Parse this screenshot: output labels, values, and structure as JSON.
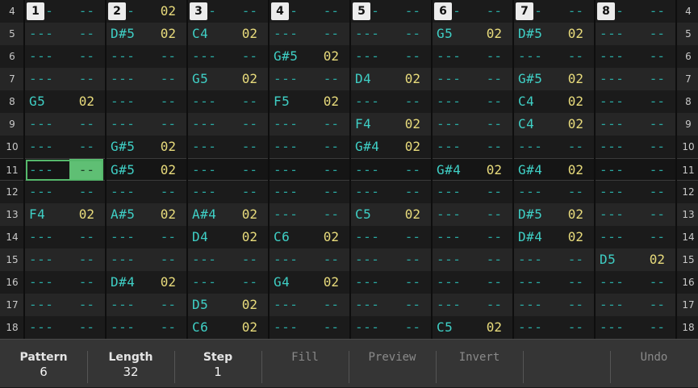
{
  "channels": [
    {
      "label": "1"
    },
    {
      "label": "2"
    },
    {
      "label": "3"
    },
    {
      "label": "4"
    },
    {
      "label": "5"
    },
    {
      "label": "6"
    },
    {
      "label": "7"
    },
    {
      "label": "8"
    }
  ],
  "rows": [
    {
      "num": "4",
      "cells": [
        [
          "---",
          "--"
        ],
        [
          "---",
          "02"
        ],
        [
          "---",
          "--"
        ],
        [
          "---",
          "--"
        ],
        [
          "---",
          "--"
        ],
        [
          "---",
          "--"
        ],
        [
          "---",
          "--"
        ],
        [
          "---",
          "--"
        ]
      ]
    },
    {
      "num": "5",
      "cells": [
        [
          "---",
          "--"
        ],
        [
          "D#5",
          "02"
        ],
        [
          "C4",
          "02"
        ],
        [
          "---",
          "--"
        ],
        [
          "---",
          "--"
        ],
        [
          "G5",
          "02"
        ],
        [
          "D#5",
          "02"
        ],
        [
          "---",
          "--"
        ]
      ]
    },
    {
      "num": "6",
      "cells": [
        [
          "---",
          "--"
        ],
        [
          "---",
          "--"
        ],
        [
          "---",
          "--"
        ],
        [
          "G#5",
          "02"
        ],
        [
          "---",
          "--"
        ],
        [
          "---",
          "--"
        ],
        [
          "---",
          "--"
        ],
        [
          "---",
          "--"
        ]
      ]
    },
    {
      "num": "7",
      "cells": [
        [
          "---",
          "--"
        ],
        [
          "---",
          "--"
        ],
        [
          "G5",
          "02"
        ],
        [
          "---",
          "--"
        ],
        [
          "D4",
          "02"
        ],
        [
          "---",
          "--"
        ],
        [
          "G#5",
          "02"
        ],
        [
          "---",
          "--"
        ]
      ]
    },
    {
      "num": "8",
      "cells": [
        [
          "G5",
          "02"
        ],
        [
          "---",
          "--"
        ],
        [
          "---",
          "--"
        ],
        [
          "F5",
          "02"
        ],
        [
          "---",
          "--"
        ],
        [
          "---",
          "--"
        ],
        [
          "C4",
          "02"
        ],
        [
          "---",
          "--"
        ]
      ]
    },
    {
      "num": "9",
      "cells": [
        [
          "---",
          "--"
        ],
        [
          "---",
          "--"
        ],
        [
          "---",
          "--"
        ],
        [
          "---",
          "--"
        ],
        [
          "F4",
          "02"
        ],
        [
          "---",
          "--"
        ],
        [
          "C4",
          "02"
        ],
        [
          "---",
          "--"
        ]
      ]
    },
    {
      "num": "10",
      "cells": [
        [
          "---",
          "--"
        ],
        [
          "G#5",
          "02"
        ],
        [
          "---",
          "--"
        ],
        [
          "---",
          "--"
        ],
        [
          "G#4",
          "02"
        ],
        [
          "---",
          "--"
        ],
        [
          "---",
          "--"
        ],
        [
          "---",
          "--"
        ]
      ]
    },
    {
      "num": "11",
      "cells": [
        [
          "---",
          "--"
        ],
        [
          "G#5",
          "02"
        ],
        [
          "---",
          "--"
        ],
        [
          "---",
          "--"
        ],
        [
          "---",
          "--"
        ],
        [
          "G#4",
          "02"
        ],
        [
          "G#4",
          "02"
        ],
        [
          "---",
          "--"
        ]
      ]
    },
    {
      "num": "12",
      "cells": [
        [
          "---",
          "--"
        ],
        [
          "---",
          "--"
        ],
        [
          "---",
          "--"
        ],
        [
          "---",
          "--"
        ],
        [
          "---",
          "--"
        ],
        [
          "---",
          "--"
        ],
        [
          "---",
          "--"
        ],
        [
          "---",
          "--"
        ]
      ]
    },
    {
      "num": "13",
      "cells": [
        [
          "F4",
          "02"
        ],
        [
          "A#5",
          "02"
        ],
        [
          "A#4",
          "02"
        ],
        [
          "---",
          "--"
        ],
        [
          "C5",
          "02"
        ],
        [
          "---",
          "--"
        ],
        [
          "D#5",
          "02"
        ],
        [
          "---",
          "--"
        ]
      ]
    },
    {
      "num": "14",
      "cells": [
        [
          "---",
          "--"
        ],
        [
          "---",
          "--"
        ],
        [
          "D4",
          "02"
        ],
        [
          "C6",
          "02"
        ],
        [
          "---",
          "--"
        ],
        [
          "---",
          "--"
        ],
        [
          "D#4",
          "02"
        ],
        [
          "---",
          "--"
        ]
      ]
    },
    {
      "num": "15",
      "cells": [
        [
          "---",
          "--"
        ],
        [
          "---",
          "--"
        ],
        [
          "---",
          "--"
        ],
        [
          "---",
          "--"
        ],
        [
          "---",
          "--"
        ],
        [
          "---",
          "--"
        ],
        [
          "---",
          "--"
        ],
        [
          "D5",
          "02"
        ]
      ]
    },
    {
      "num": "16",
      "cells": [
        [
          "---",
          "--"
        ],
        [
          "D#4",
          "02"
        ],
        [
          "---",
          "--"
        ],
        [
          "G4",
          "02"
        ],
        [
          "---",
          "--"
        ],
        [
          "---",
          "--"
        ],
        [
          "---",
          "--"
        ],
        [
          "---",
          "--"
        ]
      ]
    },
    {
      "num": "17",
      "cells": [
        [
          "---",
          "--"
        ],
        [
          "---",
          "--"
        ],
        [
          "D5",
          "02"
        ],
        [
          "---",
          "--"
        ],
        [
          "---",
          "--"
        ],
        [
          "---",
          "--"
        ],
        [
          "---",
          "--"
        ],
        [
          "---",
          "--"
        ]
      ]
    },
    {
      "num": "18",
      "cells": [
        [
          "---",
          "--"
        ],
        [
          "---",
          "--"
        ],
        [
          "C6",
          "02"
        ],
        [
          "---",
          "--"
        ],
        [
          "---",
          "--"
        ],
        [
          "C5",
          "02"
        ],
        [
          "---",
          "--"
        ],
        [
          "---",
          "--"
        ]
      ]
    }
  ],
  "cursor": {
    "row_number": "11",
    "channel": "1"
  },
  "toolbar": [
    {
      "label": "Pattern",
      "value": "6",
      "enabled": true
    },
    {
      "label": "Length",
      "value": "32",
      "enabled": true
    },
    {
      "label": "Step",
      "value": "1",
      "enabled": true
    },
    {
      "label": "Fill",
      "value": "",
      "enabled": false
    },
    {
      "label": "Preview",
      "value": "",
      "enabled": false
    },
    {
      "label": "Invert",
      "value": "",
      "enabled": false
    },
    {
      "label": "",
      "value": "",
      "enabled": false
    },
    {
      "label": "Undo",
      "value": "",
      "enabled": false
    }
  ],
  "colors": {
    "note": "#3fd0c6",
    "empty": "#2aa9a2",
    "volume": "#e9dc7c",
    "cursor": "#5fbf74"
  }
}
